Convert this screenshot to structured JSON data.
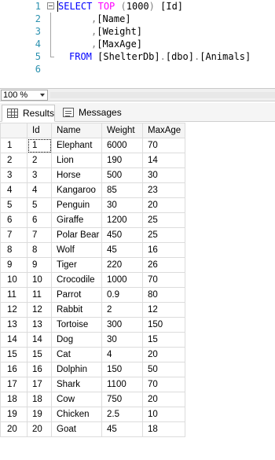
{
  "editor": {
    "lines": [
      {
        "num": "1"
      },
      {
        "num": "2"
      },
      {
        "num": "3"
      },
      {
        "num": "4"
      },
      {
        "num": "5"
      },
      {
        "num": "6"
      }
    ],
    "query": {
      "select_kw": "SELECT",
      "top_kw": "TOP",
      "top_open": "(",
      "top_value": "1000",
      "top_close": ")",
      "col_id": "[Id]",
      "comma": ",",
      "col_name": "[Name]",
      "col_weight": "[Weight]",
      "col_maxage": "[MaxAge]",
      "from_kw": "FROM",
      "db": "[ShelterDb]",
      "dot": ".",
      "schema": "[dbo]",
      "table": "[Animals]"
    }
  },
  "zoom": {
    "value": "100 %"
  },
  "tabs": {
    "results": "Results",
    "messages": "Messages"
  },
  "grid": {
    "columns": [
      "Id",
      "Name",
      "Weight",
      "MaxAge"
    ],
    "rows": [
      {
        "n": "1",
        "id": "1",
        "name": "Elephant",
        "weight": "6000",
        "maxage": "70"
      },
      {
        "n": "2",
        "id": "2",
        "name": "Lion",
        "weight": "190",
        "maxage": "14"
      },
      {
        "n": "3",
        "id": "3",
        "name": "Horse",
        "weight": "500",
        "maxage": "30"
      },
      {
        "n": "4",
        "id": "4",
        "name": "Kangaroo",
        "weight": "85",
        "maxage": "23"
      },
      {
        "n": "5",
        "id": "5",
        "name": "Penguin",
        "weight": "30",
        "maxage": "20"
      },
      {
        "n": "6",
        "id": "6",
        "name": "Giraffe",
        "weight": "1200",
        "maxage": "25"
      },
      {
        "n": "7",
        "id": "7",
        "name": "Polar Bear",
        "weight": "450",
        "maxage": "25"
      },
      {
        "n": "8",
        "id": "8",
        "name": "Wolf",
        "weight": "45",
        "maxage": "16"
      },
      {
        "n": "9",
        "id": "9",
        "name": "Tiger",
        "weight": "220",
        "maxage": "26"
      },
      {
        "n": "10",
        "id": "10",
        "name": "Crocodile",
        "weight": "1000",
        "maxage": "70"
      },
      {
        "n": "11",
        "id": "11",
        "name": "Parrot",
        "weight": "0.9",
        "maxage": "80"
      },
      {
        "n": "12",
        "id": "12",
        "name": "Rabbit",
        "weight": "2",
        "maxage": "12"
      },
      {
        "n": "13",
        "id": "13",
        "name": "Tortoise",
        "weight": "300",
        "maxage": "150"
      },
      {
        "n": "14",
        "id": "14",
        "name": "Dog",
        "weight": "30",
        "maxage": "15"
      },
      {
        "n": "15",
        "id": "15",
        "name": "Cat",
        "weight": "4",
        "maxage": "20"
      },
      {
        "n": "16",
        "id": "16",
        "name": "Dolphin",
        "weight": "150",
        "maxage": "50"
      },
      {
        "n": "17",
        "id": "17",
        "name": "Shark",
        "weight": "1100",
        "maxage": "70"
      },
      {
        "n": "18",
        "id": "18",
        "name": "Cow",
        "weight": "750",
        "maxage": "20"
      },
      {
        "n": "19",
        "id": "19",
        "name": "Chicken",
        "weight": "2.5",
        "maxage": "10"
      },
      {
        "n": "20",
        "id": "20",
        "name": "Goat",
        "weight": "45",
        "maxage": "18"
      }
    ]
  }
}
